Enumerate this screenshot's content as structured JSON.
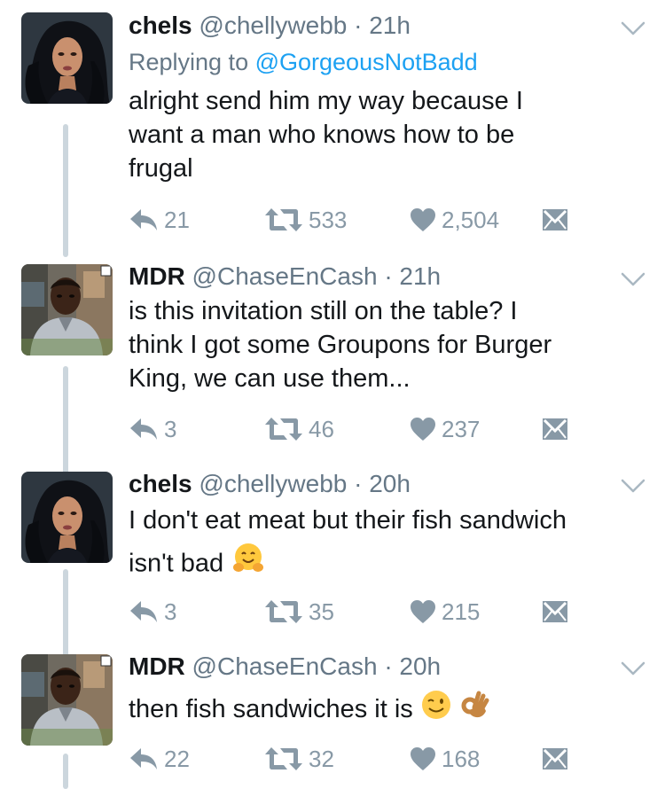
{
  "tweets": [
    {
      "name": "chels",
      "handle": "@chellywebb",
      "time": "· 21h",
      "reply_prefix": "Replying to",
      "reply_to": "@GorgeousNotBadd",
      "text_lines": [
        "alright send him my way because I",
        "want a man who knows how to be",
        "frugal"
      ],
      "replies": "21",
      "retweets": "533",
      "likes": "2,504"
    },
    {
      "name": "MDR",
      "handle": "@ChaseEnCash",
      "time": "· 21h",
      "text_lines": [
        "is this invitation still on the table? I",
        "think I got some Groupons for Burger",
        "King, we can use them..."
      ],
      "replies": "3",
      "retweets": "46",
      "likes": "237"
    },
    {
      "name": "chels",
      "handle": "@chellywebb",
      "time": "· 20h",
      "text_line1": "I don't eat meat but their fish sandwich",
      "text_line2": "isn't bad",
      "replies": "3",
      "retweets": "35",
      "likes": "215"
    },
    {
      "name": "MDR",
      "handle": "@ChaseEnCash",
      "time": "· 20h",
      "text": "then fish sandwiches it is",
      "replies": "22",
      "retweets": "32",
      "likes": "168"
    }
  ],
  "colors": {
    "text": "#14171a",
    "muted": "#657786",
    "icon": "#8899a6",
    "link": "#1da1f2",
    "thread": "#ccd6dd"
  },
  "icons": [
    "chevron-down-icon",
    "reply-icon",
    "retweet-icon",
    "heart-icon",
    "direct-message-icon",
    "hugging-face-emoji",
    "winking-face-emoji",
    "ok-hand-emoji"
  ]
}
